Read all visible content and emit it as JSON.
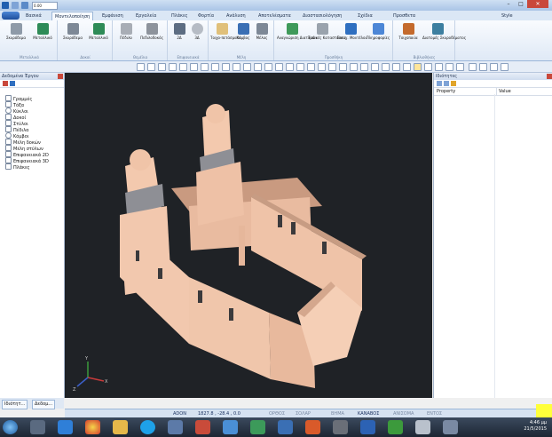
{
  "titlebar": {
    "title": "",
    "quick_access_combo": "0.00",
    "style_label": "Style"
  },
  "tabs": [
    {
      "label": "Βασικά"
    },
    {
      "label": "Μοντελοποίηση",
      "active": true
    },
    {
      "label": "Εμφάνιση"
    },
    {
      "label": "Εργαλεία"
    },
    {
      "label": "Πλάκες"
    },
    {
      "label": "Φορτία"
    },
    {
      "label": "Ανάλυση"
    },
    {
      "label": "Αποτελέσματα"
    },
    {
      "label": "Διαστασιολόγηση"
    },
    {
      "label": "Σχέδια"
    },
    {
      "label": "Προσθετα"
    }
  ],
  "ribbon": {
    "groups": [
      {
        "label": "Μεταλλικά",
        "buttons": [
          "Σκυρόδεμα",
          "Μεταλλικό"
        ]
      },
      {
        "label": "Δοκοί",
        "buttons": [
          "Σκυρόδεμα",
          "Μεταλλικό"
        ]
      },
      {
        "label": "Θεμέλια",
        "buttons": [
          "Πέδιλο",
          "Πεδιλοδοκός"
        ]
      },
      {
        "label": "Επιφανειακά",
        "buttons": [
          "2Δ",
          "3Δ"
        ]
      },
      {
        "label": "Μέλη",
        "buttons": [
          "Τοιχο-πετάσματα",
          "Κόμβος",
          "Μέλος"
        ]
      },
      {
        "label": "Προσθήκη",
        "buttons": [
          "Αναγνώριση Διατομών",
          "Τοπικές Καταστάσεις",
          "Εισαγ. Μοντέλου",
          "Πληροφορίες"
        ]
      },
      {
        "label": "Βιβλιοθήκες",
        "buttons": [
          "Τοιχοποιία",
          "Διατομές Σκυροδέματος"
        ]
      }
    ]
  },
  "left_panel": {
    "title": "Δεδομένα Έργου",
    "tree": [
      "Γραμμές",
      "Τόξα",
      "Κύκλοι",
      "Δοκοί",
      "Στύλοι",
      "Πέδιλα",
      "Κόμβοι",
      "Μέλη δοκών",
      "Μέλη στύλων",
      "Επιφανειακά 2D",
      "Επιφανειακά 3D",
      "Πλάκες"
    ],
    "bottom_tabs": [
      "Ιδιότητ...",
      "Δεδομ..."
    ]
  },
  "right_panel": {
    "title": "Ιδιότητες",
    "col_property": "Property",
    "col_value": "Value"
  },
  "status": {
    "name": "ADON",
    "coords": "1827.8 , -28.4 , 0.0",
    "toggles": [
      "ΟΡΘΟΣ",
      "ΣΟΛΑΡ",
      "ΒΗΜΑ",
      "ΚΑΝΑΒΟΣ",
      "ΑΝΙΣΟΜΑ",
      "ΕΝΤΟΣ"
    ]
  },
  "taskbar": {
    "time": "4:46 μμ",
    "date": "21/5/2015"
  },
  "colors": {
    "viewport_bg": "#1f2226",
    "model_light": "#f2c8ae",
    "model_mid": "#dca98c",
    "model_dark": "#8e8f95",
    "accent": "#2f6fc0"
  },
  "axis": {
    "x": "X",
    "y": "Y",
    "z": "Z"
  }
}
